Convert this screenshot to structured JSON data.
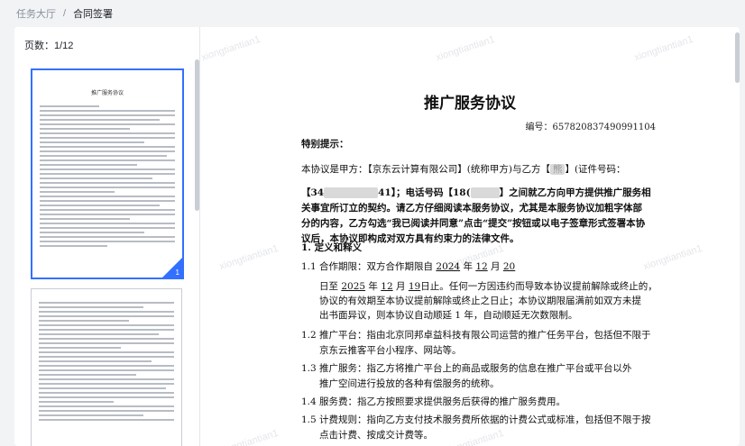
{
  "breadcrumb": {
    "parent": "任务大厅",
    "sep": "/",
    "current": "合同签署"
  },
  "thumbnails": {
    "pages_label": "页数：1/12",
    "page1_title": "推广服务协议",
    "page1_badge": "1"
  },
  "watermark": "xiongtiantian1",
  "document": {
    "title": "推广服务协议",
    "number_label": "编号：657820837490991104",
    "notice_heading": "特别提示：",
    "intro1": "本协议是甲方：【京东云计算有限公司】(统称甲方)与乙方【",
    "intro1_masked": "熊",
    "intro1_end": "】(证件号码：",
    "intro2_prefix": "【34",
    "intro2_masked1": "",
    "intro2_mid": "41】；电话号码【18(",
    "intro2_masked2": "",
    "intro2_end": "】之间就乙方向甲方提供推广服务相",
    "intro3": "关事宜所订立的契约。请乙方仔细阅读本服务协议，尤其是本服务协议加粗字体部",
    "intro4": "分的内容，乙方勾选“我已阅读并同意”点击“提交”按钮或以电子签章形式签署本协",
    "intro5": "议后，本协议即构成对双方具有约束力的法律文件。",
    "section1": "1. 定义和释义",
    "s11a": "1.1 合作期限：双方合作期限自",
    "s11_y1": "2024",
    "s11_y1s": "年",
    "s11_m1": "12",
    "s11_m1s": "月",
    "s11_d1": "20",
    "s11b_pre": "日至",
    "s11_y2": "2025",
    "s11_y2s": "年",
    "s11_m2": "12",
    "s11_m2s": "月",
    "s11_d2": "19",
    "s11b_end": "日止。任何一方因违约而导致本协议提前解除或终止的，",
    "s11c": "协议的有效期至本协议提前解除或终止之日止；本协议期限届满前如双方未提",
    "s11d": "出书面异议，则本协议自动顺延 1 年，自动顺延无次数限制。",
    "s12a": "1.2  推广平台：指由北京同邦卓益科技有限公司运营的推广任务平台，包括但不限于",
    "s12b": "京东云推客平台小程序、网站等。",
    "s13a": "1.3 推广服务：指乙方将推广平台上的商品或服务的信息在推广平台或平台以外",
    "s13b": "推广空间进行投放的各种有偿服务的统称。",
    "s14": "1.4 服务费：指乙方按照要求提供服务后获得的推广服务费用。",
    "s15a": "1.5  计费规则：指向乙方支付技术服务费所依据的计费公式或标准，包括但不限于按",
    "s15b": "点击计费、按成交计费等。"
  }
}
